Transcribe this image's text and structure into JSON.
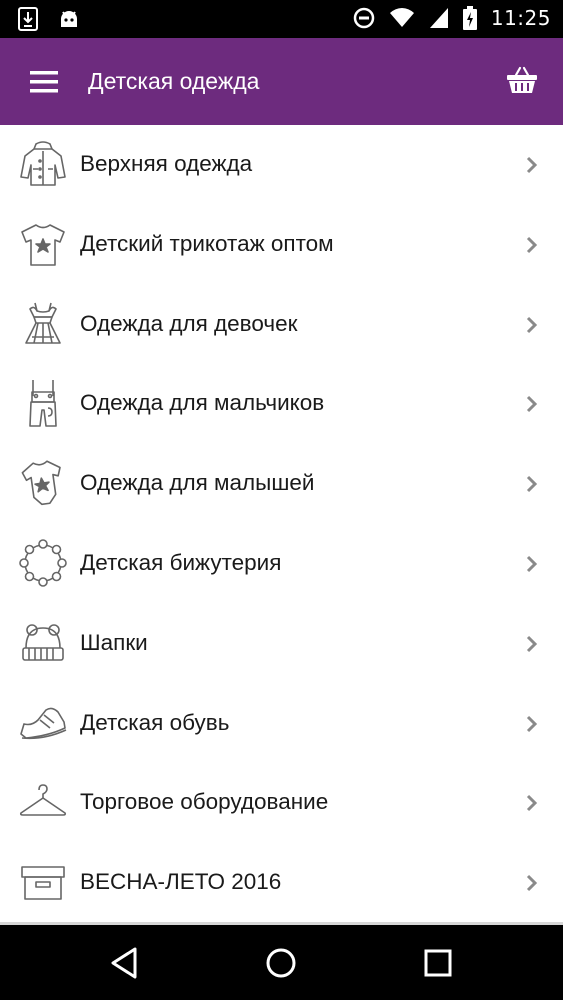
{
  "status_bar": {
    "time": "11:25",
    "icons": [
      "download-icon",
      "android-icon",
      "do-not-disturb-icon",
      "wifi-icon",
      "cellular-signal-icon",
      "battery-charging-icon"
    ]
  },
  "app_bar": {
    "title": "Детская одежда",
    "background": "#6d2b7e"
  },
  "categories": [
    {
      "label": "Верхняя одежда",
      "icon": "jacket-icon"
    },
    {
      "label": "Детский трикотаж оптом",
      "icon": "tshirt-icon"
    },
    {
      "label": "Одежда для девочек",
      "icon": "dress-icon"
    },
    {
      "label": "Одежда для мальчиков",
      "icon": "overalls-icon"
    },
    {
      "label": "Одежда для малышей",
      "icon": "bodysuit-icon"
    },
    {
      "label": "Детская бижутерия",
      "icon": "necklace-icon"
    },
    {
      "label": "Шапки",
      "icon": "hat-icon"
    },
    {
      "label": "Детская обувь",
      "icon": "shoe-icon"
    },
    {
      "label": "Торговое оборудование",
      "icon": "hanger-icon"
    },
    {
      "label": "ВЕСНА-ЛЕТО 2016",
      "icon": "box-icon"
    }
  ],
  "nav_bar": {
    "icons": [
      "back-icon",
      "home-icon",
      "recents-icon"
    ]
  }
}
